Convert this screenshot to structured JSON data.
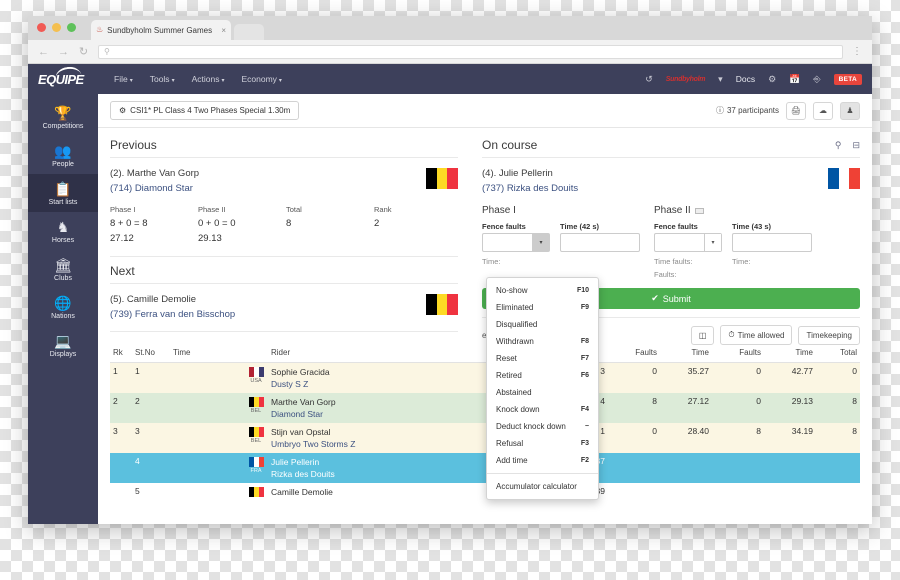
{
  "browser": {
    "tab_title": "Sundbyholm Summer Games",
    "tab_close": "×",
    "url_value": "",
    "back_icon": "←",
    "forward_icon": "→",
    "reload_icon": "↻",
    "search_icon": "⚲",
    "menu_icon": "⋮"
  },
  "header": {
    "logo": "EQUIPE",
    "menus": [
      {
        "label": "File",
        "caret": "▾"
      },
      {
        "label": "Tools",
        "caret": "▾"
      },
      {
        "label": "Actions",
        "caret": "▾"
      },
      {
        "label": "Economy",
        "caret": "▾"
      }
    ],
    "history_icon": "↺",
    "org_logo": "Sundbyholm",
    "org_caret": "▾",
    "docs_label": "Docs",
    "gear_icon": "⚙",
    "calendar_icon": "Ὄ5",
    "help_icon": "?",
    "beta_label": "BETA"
  },
  "sidebar": {
    "items": [
      {
        "label": "Competitions",
        "icon": "🏆",
        "active": false
      },
      {
        "label": "People",
        "icon": "👥",
        "active": false
      },
      {
        "label": "Start lists",
        "icon": "📋",
        "active": true
      },
      {
        "label": "Horses",
        "icon": "♞",
        "active": false
      },
      {
        "label": "Clubs",
        "icon": "🏛",
        "active": false
      },
      {
        "label": "Nations",
        "icon": "🌐",
        "active": false
      },
      {
        "label": "Displays",
        "icon": "🖥",
        "active": false
      }
    ]
  },
  "classbar": {
    "gear_icon": "⚙",
    "class_name": "CSI1* PL Class 4 Two Phases Special 1.30m",
    "participants_icon": "ℹ",
    "participants": "37 participants",
    "print_icon": "⎙",
    "cloud_icon": "☁",
    "person_icon": "♟"
  },
  "previous": {
    "title": "Previous",
    "rider": "(2). Marthe Van Gorp",
    "horse": "(714) Diamond Star",
    "flag_colors": [
      "#000000",
      "#fdda24",
      "#ef3340"
    ],
    "cols": [
      {
        "label": "Phase I",
        "value": "8 + 0 = 8",
        "time": "27.12"
      },
      {
        "label": "Phase II",
        "value": "0 + 0 = 0",
        "time": "29.13"
      },
      {
        "label": "Total",
        "value": "8",
        "time": ""
      },
      {
        "label": "Rank",
        "value": "2",
        "time": ""
      }
    ]
  },
  "next": {
    "title": "Next",
    "rider": "(5). Camille Demolie",
    "horse": "(739) Ferra van den Bisschop",
    "flag_colors": [
      "#000000",
      "#fdda24",
      "#ef3340"
    ]
  },
  "oncourse": {
    "title": "On course",
    "search_icon": "⚲",
    "panel_icon": "⊟",
    "rider": "(4). Julie Pellerin",
    "horse": "(737) Rizka des Douits",
    "flag_colors": [
      "#0055a4",
      "#ffffff",
      "#ef4135"
    ],
    "phase1": {
      "heading": "Phase I",
      "fence_label": "Fence faults",
      "fence_value": "",
      "time_label": "Time (42 s)",
      "time_value": "",
      "sub1": "Time:",
      "sub2": ""
    },
    "phase2": {
      "heading": "Phase II",
      "fence_label": "Fence faults",
      "fence_value": "",
      "time_label": "Time (43 s)",
      "time_value": "",
      "sub1": "Time faults:",
      "sub2": "Faults:",
      "sub3": "Time:"
    },
    "submit_label": "Submit",
    "submit_check": "✔",
    "submit_color": "#4caf50",
    "status_text": "es 12 placings, 34 remaining",
    "buttons": [
      {
        "label": "",
        "icon": "◫"
      },
      {
        "label": "Time allowed",
        "icon": "◴"
      },
      {
        "label": "Timekeeping",
        "icon": ""
      }
    ]
  },
  "dropdown": {
    "items": [
      {
        "label": "No-show",
        "key": "F10"
      },
      {
        "label": "Eliminated",
        "key": "F9"
      },
      {
        "label": "Disqualified",
        "key": ""
      },
      {
        "label": "Withdrawn",
        "key": "F8"
      },
      {
        "label": "Reset",
        "key": "F7"
      },
      {
        "label": "Retired",
        "key": "F6"
      },
      {
        "label": "Abstained",
        "key": ""
      },
      {
        "label": "Knock down",
        "key": "F4"
      },
      {
        "label": "Deduct knock down",
        "key": "−"
      },
      {
        "label": "Refusal",
        "key": "F3"
      },
      {
        "label": "Add time",
        "key": "F2"
      }
    ],
    "footer": "Accumulator calculator"
  },
  "table": {
    "headers": [
      "Rk",
      "St.No",
      "Time",
      "Rider",
      "",
      "",
      "Faults",
      "Time",
      "Faults",
      "Time",
      "Total"
    ],
    "rows": [
      {
        "rk": "1",
        "stno": "1",
        "time": "",
        "rider": "Sophie Gracida",
        "horse": "Dusty S Z",
        "nation": "USA",
        "flag_colors": [
          "#b22234",
          "#ffffff",
          "#3c3b6e"
        ],
        "horse_no": "3",
        "f1": "0",
        "t1": "35.27",
        "f2": "0",
        "t2": "42.77",
        "total": "0",
        "style": "r-cream"
      },
      {
        "rk": "2",
        "stno": "2",
        "time": "",
        "rider": "Marthe Van Gorp",
        "horse": "Diamond Star",
        "nation": "BEL",
        "flag_colors": [
          "#000000",
          "#fdda24",
          "#ef3340"
        ],
        "horse_no": "4",
        "f1": "8",
        "t1": "27.12",
        "f2": "0",
        "t2": "29.13",
        "total": "8",
        "style": "r-green"
      },
      {
        "rk": "3",
        "stno": "3",
        "time": "",
        "rider": "Stijn van Opstal",
        "horse": "Umbryo Two Storms Z",
        "nation": "BEL",
        "flag_colors": [
          "#000000",
          "#fdda24",
          "#ef3340"
        ],
        "horse_no": "1",
        "f1": "0",
        "t1": "28.40",
        "f2": "8",
        "t2": "34.19",
        "total": "8",
        "style": "r-cream"
      },
      {
        "rk": "",
        "stno": "4",
        "time": "",
        "rider": "Julie Pellerin",
        "horse": "Rizka des Douits",
        "nation": "FRA",
        "flag_colors": [
          "#0055a4",
          "#ffffff",
          "#ef4135"
        ],
        "horse_no": "737",
        "f1": "",
        "t1": "",
        "f2": "",
        "t2": "",
        "total": "",
        "style": "r-blue"
      },
      {
        "rk": "",
        "stno": "5",
        "time": "",
        "rider": "Camille Demolie",
        "horse": "",
        "nation": "BEL",
        "flag_colors": [
          "#000000",
          "#fdda24",
          "#ef3340"
        ],
        "horse_no": "739",
        "f1": "",
        "t1": "",
        "f2": "",
        "t2": "",
        "total": "",
        "style": ""
      }
    ]
  }
}
